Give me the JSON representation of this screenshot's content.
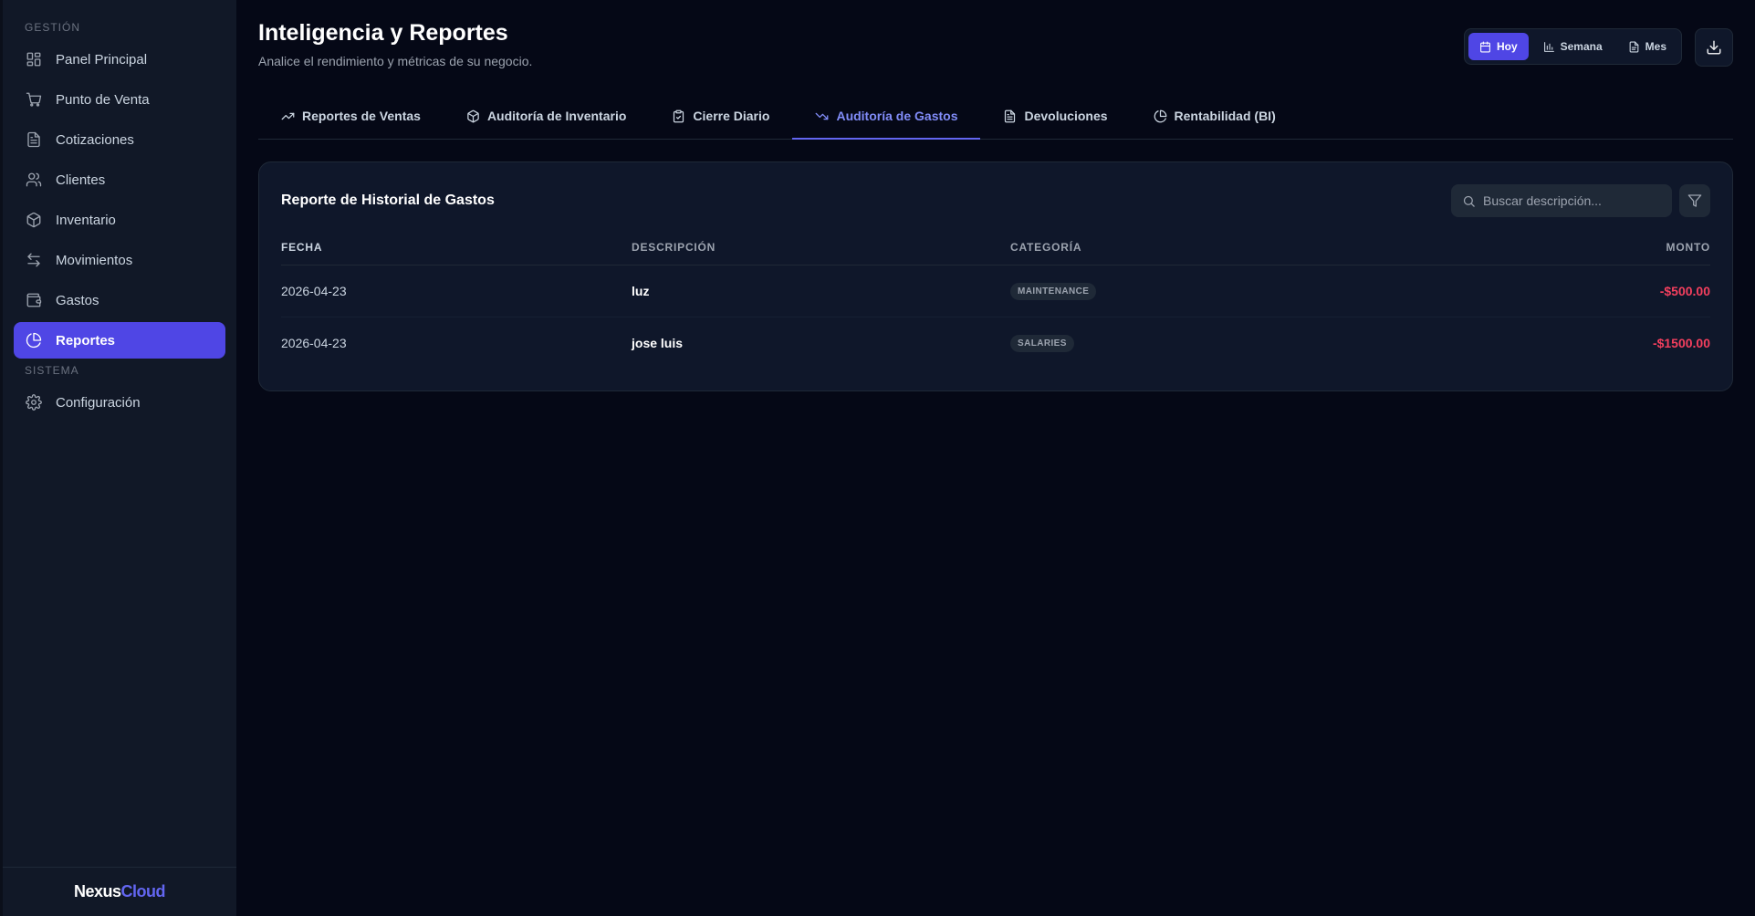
{
  "sidebar": {
    "section_management": "GESTIÓN",
    "items": [
      {
        "label": "Panel Principal",
        "icon": "dashboard-icon"
      },
      {
        "label": "Punto de Venta",
        "icon": "cart-icon"
      },
      {
        "label": "Cotizaciones",
        "icon": "document-icon"
      },
      {
        "label": "Clientes",
        "icon": "users-icon"
      },
      {
        "label": "Inventario",
        "icon": "box-icon"
      },
      {
        "label": "Movimientos",
        "icon": "arrows-icon"
      },
      {
        "label": "Gastos",
        "icon": "wallet-icon"
      },
      {
        "label": "Reportes",
        "icon": "pie-chart-icon",
        "active": true
      }
    ],
    "section_system": "SISTEMA",
    "settings_label": "Configuración",
    "brand_part1": "Nexus",
    "brand_part2": "Cloud"
  },
  "header": {
    "title": "Inteligencia y Reportes",
    "subtitle": "Analice el rendimiento y métricas de su negocio.",
    "range": {
      "today": "Hoy",
      "week": "Semana",
      "month": "Mes",
      "selected": "Hoy"
    }
  },
  "tabs": [
    {
      "label": "Reportes de Ventas",
      "icon": "trending-up-icon"
    },
    {
      "label": "Auditoría de Inventario",
      "icon": "box-icon"
    },
    {
      "label": "Cierre Diario",
      "icon": "clipboard-check-icon"
    },
    {
      "label": "Auditoría de Gastos",
      "icon": "trending-down-icon",
      "active": true
    },
    {
      "label": "Devoluciones",
      "icon": "file-icon"
    },
    {
      "label": "Rentabilidad (BI)",
      "icon": "pie-chart-icon"
    }
  ],
  "report": {
    "title": "Reporte de Historial de Gastos",
    "search_placeholder": "Buscar descripción...",
    "columns": {
      "date": "FECHA",
      "description": "DESCRIPCIÓN",
      "category": "CATEGORÍA",
      "amount": "MONTO"
    },
    "rows": [
      {
        "date": "2026-04-23",
        "description": "luz",
        "category": "MAINTENANCE",
        "amount": "-$500.00"
      },
      {
        "date": "2026-04-23",
        "description": "jose luis",
        "category": "SALARIES",
        "amount": "-$1500.00"
      }
    ]
  },
  "colors": {
    "accent": "#4f46e5",
    "negative": "#f43f5e",
    "background": "#050816",
    "sidebar": "#111827"
  }
}
